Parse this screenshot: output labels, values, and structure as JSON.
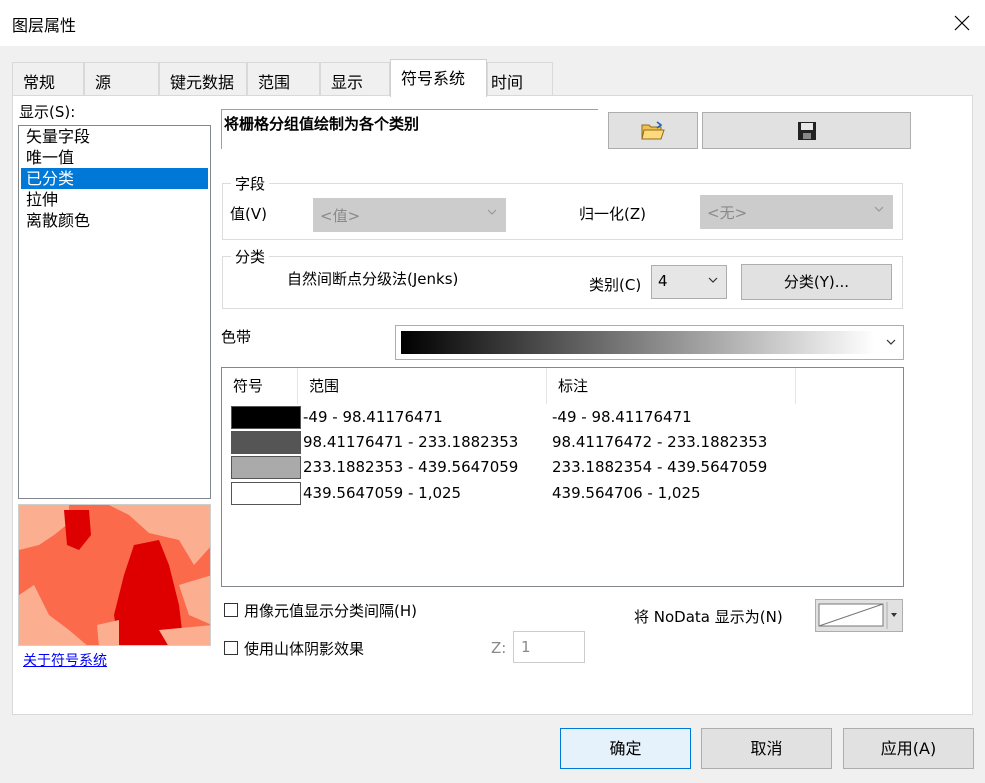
{
  "window": {
    "title": "图层属性"
  },
  "tabs": [
    {
      "label": "常规"
    },
    {
      "label": "源"
    },
    {
      "label": "键元数据"
    },
    {
      "label": "范围"
    },
    {
      "label": "显示"
    },
    {
      "label": "符号系统",
      "active": true
    },
    {
      "label": "时间"
    }
  ],
  "show": {
    "label": "显示(S):",
    "items": [
      "矢量字段",
      "唯一值",
      "已分类",
      "拉伸",
      "离散颜色"
    ],
    "selected": "已分类",
    "about_link": "关于符号系统"
  },
  "description": "将栅格分组值绘制为各个类别",
  "field": {
    "title": "字段",
    "value_label": "值(V)",
    "value_select": "<值>",
    "normalize_label": "归一化(Z)",
    "normalize_select": "<无>"
  },
  "classification": {
    "title": "分类",
    "method": "自然间断点分级法(Jenks)",
    "classes_label": "类别(C)",
    "classes_value": "4",
    "classify_button": "分类(Y)..."
  },
  "color_ramp": {
    "label": "色带",
    "start": "#000000",
    "end": "#ffffff"
  },
  "legend": {
    "headers": [
      "符号",
      "范围",
      "标注"
    ],
    "rows": [
      {
        "color": "#000000",
        "range": "-49 - 98.41176471",
        "label": "-49 - 98.41176471"
      },
      {
        "color": "#555555",
        "range": "98.41176471 - 233.1882353",
        "label": "98.41176472 - 233.1882353"
      },
      {
        "color": "#aaaaaa",
        "range": "233.1882353 - 439.5647059",
        "label": "233.1882354 - 439.5647059"
      },
      {
        "color": "#ffffff",
        "range": "439.5647059 - 1,025",
        "label": "439.564706 - 1,025"
      }
    ]
  },
  "options": {
    "show_class_breaks": "用像元值显示分类间隔(H)",
    "hillshade": "使用山体阴影效果",
    "z_label": "Z:",
    "z_value": "1",
    "nodata_label": "将 NoData 显示为(N)"
  },
  "footer": {
    "ok": "确定",
    "cancel": "取消",
    "apply": "应用(A)"
  }
}
